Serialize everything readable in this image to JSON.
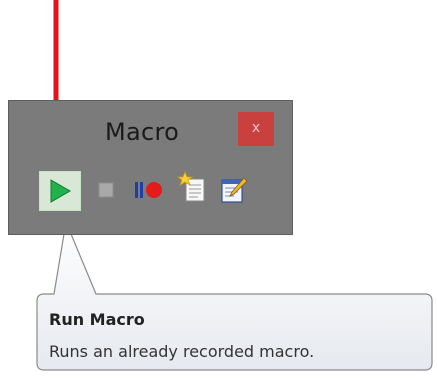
{
  "window": {
    "title": "Macro",
    "close_label": "x"
  },
  "toolbar": {
    "buttons": [
      {
        "name": "run-macro",
        "icon": "play-icon"
      },
      {
        "name": "stop-macro",
        "icon": "stop-icon"
      },
      {
        "name": "record-macro",
        "icon": "record-icon"
      },
      {
        "name": "new-macro",
        "icon": "new-document-icon"
      },
      {
        "name": "edit-macro",
        "icon": "edit-document-icon"
      }
    ]
  },
  "tooltip": {
    "title": "Run Macro",
    "description": "Runs an already recorded macro."
  },
  "colors": {
    "arrow": "#e3131b",
    "window_bg": "#7b7b7b",
    "close_bg": "#c9413e",
    "play": "#22b14c"
  }
}
